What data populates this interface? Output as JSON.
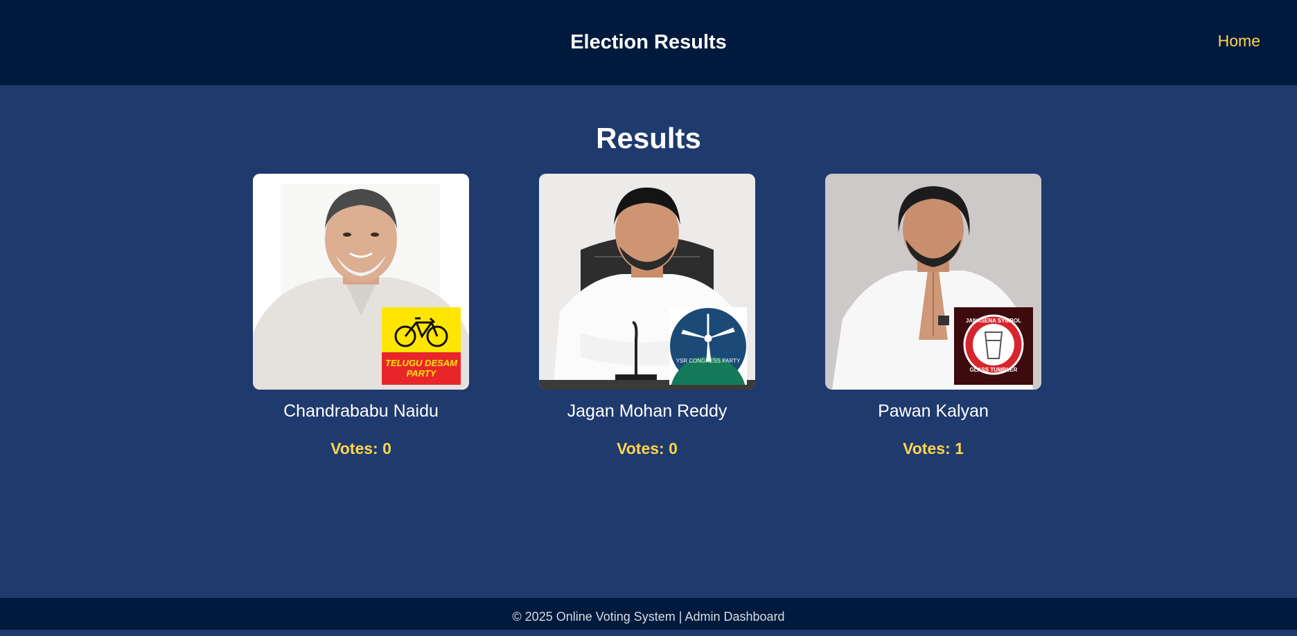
{
  "header": {
    "title": "Election Results",
    "home_label": "Home"
  },
  "main": {
    "title": "Results",
    "vote_prefix": "Votes: ",
    "candidates": [
      {
        "name": "Chandrababu Naidu",
        "votes": 0,
        "party_text": "TELUGU DESAM PARTY",
        "party_symbol": "bicycle-icon"
      },
      {
        "name": "Jagan Mohan Reddy",
        "votes": 0,
        "party_text": "YSR CONGRESS PARTY",
        "party_symbol": "ceiling-fan-icon"
      },
      {
        "name": "Pawan Kalyan",
        "votes": 1,
        "party_text": "JANASENA SYMBOL GLASS TUMBLER",
        "party_symbol": "glass-tumbler-icon"
      }
    ]
  },
  "footer": {
    "text": "© 2025 Online Voting System | Admin Dashboard"
  },
  "colors": {
    "header_bg": "#001a3d",
    "page_bg": "#1f3a6d",
    "accent": "#ffd54f"
  }
}
